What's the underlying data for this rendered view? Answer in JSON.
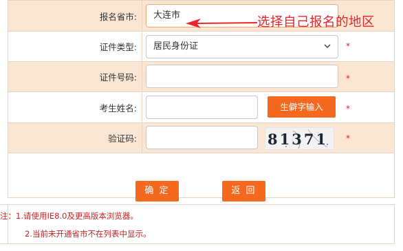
{
  "form": {
    "region": {
      "label": "报名省市:",
      "value": "大连市"
    },
    "id_type": {
      "label": "证件类型:",
      "value": "居民身份证",
      "required_mark": "*"
    },
    "id_number": {
      "label": "证件号码:",
      "value": "",
      "required_mark": "*"
    },
    "name": {
      "label": "考生姓名:",
      "value": "",
      "rare_char_button": "生僻字输入",
      "required_mark": "*"
    },
    "captcha": {
      "label": "验证码:",
      "value": "",
      "image_text": "81371",
      "required_mark": "*"
    }
  },
  "buttons": {
    "confirm": "确 定",
    "back": "返 回"
  },
  "notes": {
    "line1": "注：1.请使用IE8.0及更高版本浏览器。",
    "line2": "2.当前未开通省市不在列表中显示。"
  },
  "annotation": {
    "text": "选择自己报名的地区"
  },
  "colors": {
    "accent_orange": "#f5691f",
    "label_bg": "#fbe6d4",
    "required_red": "#e0202a",
    "annotation_red": "#e8262a"
  },
  "icons": {
    "select_caret": "chevron-down-icon",
    "annotation_arrow": "arrow-left-icon"
  }
}
